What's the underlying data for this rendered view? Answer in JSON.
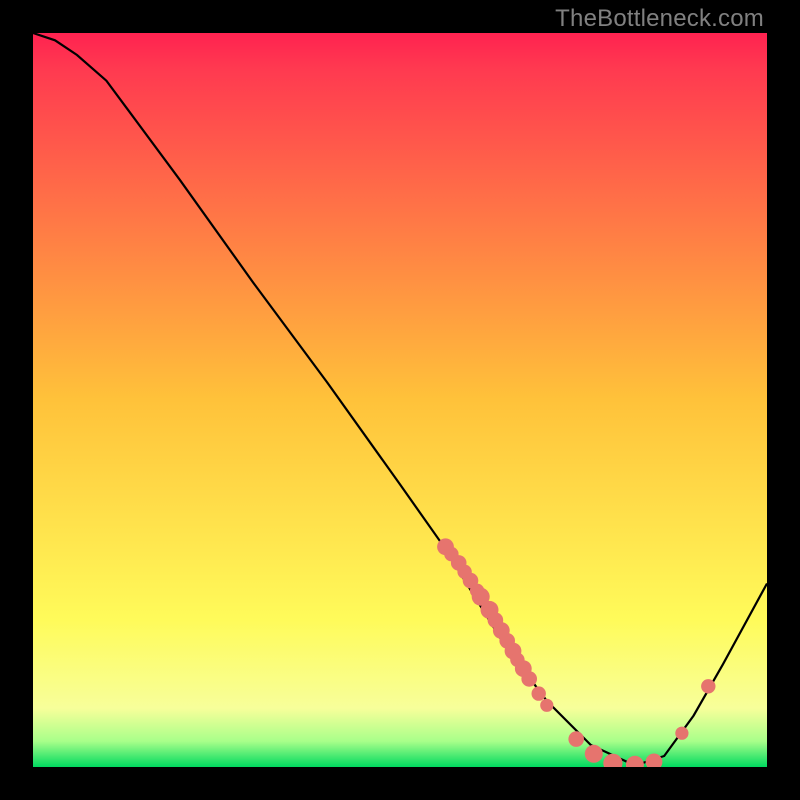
{
  "attribution": "TheBottleneck.com",
  "palette": {
    "gradient_top": "#ff2b4f",
    "gradient_mid": "#ffd93b",
    "gradient_bottom": "#00d95f",
    "curve": "#000000",
    "dots": "#e6746e",
    "frame": "#ffffff",
    "page_bg": "#000000"
  },
  "chart_data": {
    "type": "line",
    "title": "",
    "xlabel": "",
    "ylabel": "",
    "xlim": [
      0,
      100
    ],
    "ylim": [
      0,
      100
    ],
    "series": [
      {
        "name": "bottleneck-curve",
        "x": [
          0,
          3,
          6,
          10,
          20,
          30,
          40,
          50,
          56,
          60,
          64,
          70,
          76,
          82,
          86,
          90,
          94,
          100
        ],
        "y": [
          100,
          99,
          97,
          93.5,
          80,
          66,
          52.5,
          38.5,
          30,
          23.5,
          17,
          9,
          3,
          0.2,
          1.5,
          7,
          14,
          25
        ]
      }
    ],
    "scatter": [
      {
        "name": "dense-points",
        "points": [
          {
            "x": 56.2,
            "y": 30.0,
            "r": 1.4
          },
          {
            "x": 57.0,
            "y": 29.0,
            "r": 1.2
          },
          {
            "x": 58.0,
            "y": 27.8,
            "r": 1.3
          },
          {
            "x": 58.8,
            "y": 26.6,
            "r": 1.2
          },
          {
            "x": 59.6,
            "y": 25.4,
            "r": 1.3
          },
          {
            "x": 60.5,
            "y": 24.0,
            "r": 1.2
          },
          {
            "x": 61.0,
            "y": 23.2,
            "r": 1.5
          },
          {
            "x": 62.2,
            "y": 21.4,
            "r": 1.5
          },
          {
            "x": 63.0,
            "y": 20.0,
            "r": 1.3
          },
          {
            "x": 63.8,
            "y": 18.6,
            "r": 1.4
          },
          {
            "x": 64.6,
            "y": 17.2,
            "r": 1.3
          },
          {
            "x": 65.4,
            "y": 15.8,
            "r": 1.4
          },
          {
            "x": 66.0,
            "y": 14.6,
            "r": 1.2
          },
          {
            "x": 66.8,
            "y": 13.4,
            "r": 1.4
          },
          {
            "x": 67.6,
            "y": 12.0,
            "r": 1.3
          },
          {
            "x": 68.9,
            "y": 10.0,
            "r": 1.2
          },
          {
            "x": 70.0,
            "y": 8.4,
            "r": 1.1
          },
          {
            "x": 74.0,
            "y": 3.8,
            "r": 1.3
          },
          {
            "x": 76.4,
            "y": 1.8,
            "r": 1.5
          },
          {
            "x": 79.0,
            "y": 0.5,
            "r": 1.6
          },
          {
            "x": 82.0,
            "y": 0.3,
            "r": 1.5
          },
          {
            "x": 84.6,
            "y": 0.7,
            "r": 1.4
          },
          {
            "x": 88.4,
            "y": 4.6,
            "r": 1.1
          },
          {
            "x": 92.0,
            "y": 11.0,
            "r": 1.2
          }
        ]
      }
    ]
  }
}
